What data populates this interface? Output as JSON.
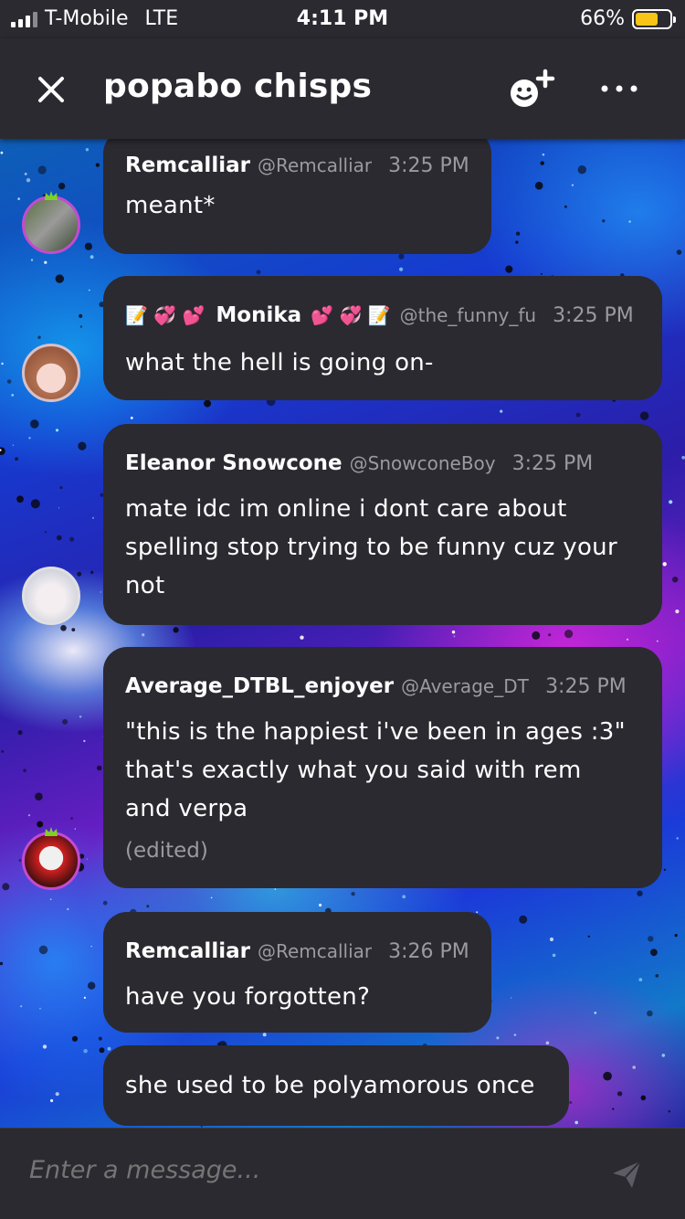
{
  "status_bar": {
    "carrier": "T-Mobile",
    "network": "LTE",
    "time": "4:11 PM",
    "battery": "66%",
    "battery_level": 0.66
  },
  "header": {
    "title": "popabo chisps",
    "icons": [
      "close-icon",
      "add-friend-icon",
      "more-options-icon"
    ]
  },
  "messages": [
    {
      "name": "Remcalliar",
      "handle": "@Remcalliar",
      "time": "3:25 PM",
      "lines": [
        "meant*"
      ]
    },
    {
      "name": "Monika",
      "name_emoji_left": "📝 💞 💕",
      "name_emoji_right": "💕 💞 📝",
      "handle": "@the_funny_fu",
      "time": "3:25 PM",
      "lines": [
        "what the hell is going on-"
      ]
    },
    {
      "name": "Eleanor Snowcone",
      "handle": "@SnowconeBoy",
      "time": "3:25 PM",
      "lines": [
        "mate idc im online i dont care about",
        "spelling stop trying to be funny cuz your",
        "not"
      ]
    },
    {
      "name": "Average_DTBL_enjoyer",
      "handle": "@Average_DTE",
      "time": "3:25 PM",
      "lines": [
        "\"this is the happiest i've been in ages :3\"",
        "that's exactly what you said with rem",
        "and verpa"
      ],
      "edited": "(edited)"
    },
    {
      "name": "Remcalliar",
      "handle": "@Remcalliar",
      "time": "3:26 PM",
      "lines": [
        "have you forgotten?"
      ]
    },
    {
      "lines": [
        "she used to be polyamorous once"
      ]
    }
  ],
  "composer": {
    "placeholder": "Enter a message...",
    "send_icon": "send-icon"
  },
  "colors": {
    "surface": "#2b2a30",
    "muted_text": "#9b9aa2",
    "battery": "#f7c417",
    "avatar_ring": "#c44ad1"
  }
}
